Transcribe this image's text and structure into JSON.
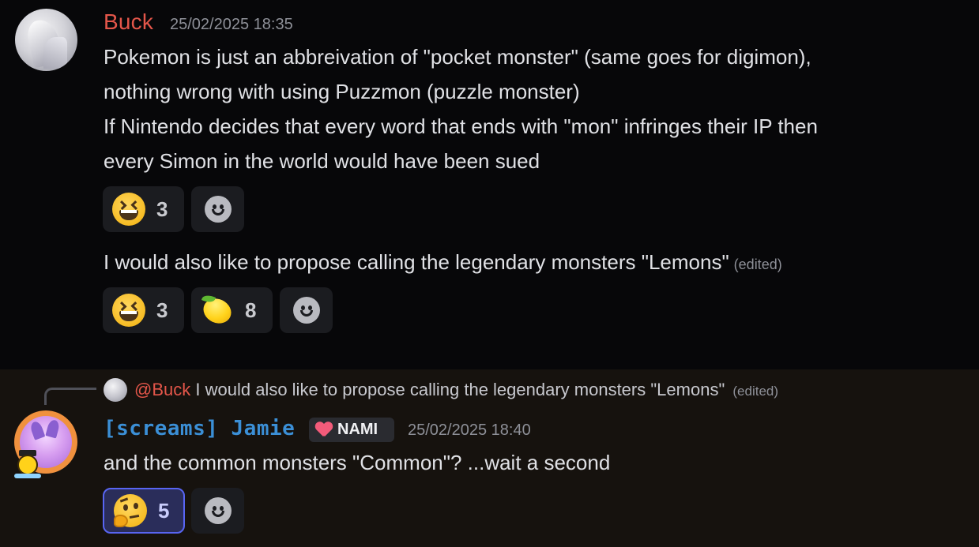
{
  "message1": {
    "author": "Buck",
    "author_color": "#e4564a",
    "timestamp": "25/02/2025 18:35",
    "lines": [
      "Pokemon is just an abbreivation of \"pocket monster\" (same goes for digimon),",
      "nothing wrong with using Puzzmon (puzzle monster)",
      "If Nintendo decides that every word that ends with \"mon\" infringes their IP then",
      "every Simon in the world would have been sued"
    ],
    "reactions": [
      {
        "emoji": "laughing-emoji",
        "count": "3"
      }
    ],
    "followup_text": "I would also like to propose calling the legendary monsters \"Lemons\"",
    "followup_edited": "(edited)",
    "followup_reactions": [
      {
        "emoji": "laughing-emoji",
        "count": "3"
      },
      {
        "emoji": "lemon-emoji",
        "count": "8"
      }
    ]
  },
  "message2": {
    "reply": {
      "mention": "@Buck",
      "text": "I would also like to propose calling the legendary monsters \"Lemons\"",
      "edited": "(edited)"
    },
    "author": "[screams] Jamie",
    "author_color": "#3b8fd6",
    "tag": "NAMI",
    "timestamp": "25/02/2025 18:40",
    "text": "and the common monsters \"Common\"? ...wait a second",
    "reactions": [
      {
        "emoji": "thinking-emoji",
        "count": "5",
        "active": true
      }
    ]
  },
  "colors": {
    "background": "#070709",
    "reply_background": "#16120e",
    "accent": "#5865f2"
  }
}
